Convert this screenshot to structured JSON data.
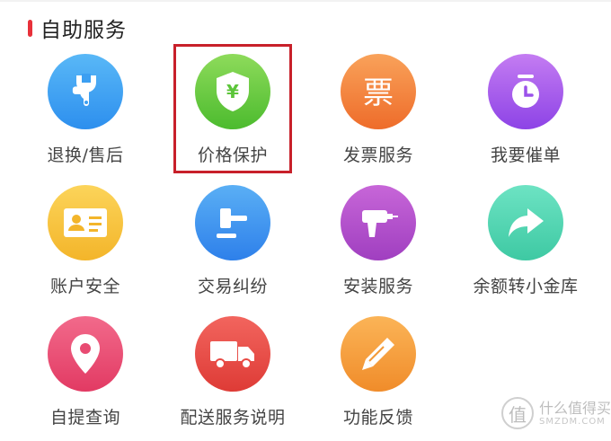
{
  "section": {
    "title": "自助服务",
    "accent_color": "#e8313a"
  },
  "services": [
    {
      "label": "退换/售后",
      "icon": "wrench-icon",
      "color_top": "#59b8f7",
      "color_bottom": "#2d8fee"
    },
    {
      "label": "价格保护",
      "icon": "shield-yen-icon",
      "color_top": "#8edb5b",
      "color_bottom": "#4cbb2e",
      "highlighted": true
    },
    {
      "label": "发票服务",
      "icon": "invoice-icon",
      "color_top": "#f9a25a",
      "color_bottom": "#ee6c2a"
    },
    {
      "label": "我要催单",
      "icon": "clock-icon",
      "color_top": "#c47cf2",
      "color_bottom": "#8d43e6"
    },
    {
      "label": "账户安全",
      "icon": "id-card-icon",
      "color_top": "#fcd45a",
      "color_bottom": "#f3b52a"
    },
    {
      "label": "交易纠纷",
      "icon": "gavel-icon",
      "color_top": "#5aaff5",
      "color_bottom": "#2e80ea"
    },
    {
      "label": "安装服务",
      "icon": "drill-icon",
      "color_top": "#c766d8",
      "color_bottom": "#a03fc0"
    },
    {
      "label": "余额转小金库",
      "icon": "forward-arrow-icon",
      "color_top": "#6de3c3",
      "color_bottom": "#3ec9a3"
    },
    {
      "label": "自提查询",
      "icon": "location-pin-icon",
      "color_top": "#f26a8b",
      "color_bottom": "#e23a63"
    },
    {
      "label": "配送服务说明",
      "icon": "delivery-truck-icon",
      "color_top": "#f2655e",
      "color_bottom": "#de3b36"
    },
    {
      "label": "功能反馈",
      "icon": "pencil-icon",
      "color_top": "#fbb457",
      "color_bottom": "#f08c2a"
    }
  ],
  "watermark": {
    "main": "什么值得买",
    "sub": "SMZDM.COM",
    "badge": "值"
  }
}
